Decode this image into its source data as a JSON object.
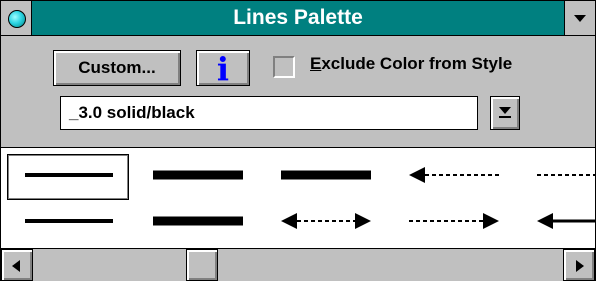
{
  "window": {
    "title": "Lines Palette"
  },
  "toolbar": {
    "custom_label": "Custom...",
    "info_label": "i",
    "exclude_checkbox": {
      "checked": false,
      "label_accel": "E",
      "label_rest": "xclude Color from Style"
    }
  },
  "style_select": {
    "value": "_3.0 solid/black"
  },
  "palette": {
    "selected_index": 0,
    "items": [
      {
        "name": "thin-solid",
        "row": 0
      },
      {
        "name": "thick-solid",
        "row": 0
      },
      {
        "name": "thick-solid-2",
        "row": 0
      },
      {
        "name": "dashed-arrow-left",
        "row": 0
      },
      {
        "name": "dashed",
        "row": 0
      },
      {
        "name": "thin-solid",
        "row": 1
      },
      {
        "name": "thick-solid",
        "row": 1
      },
      {
        "name": "dashed-double-arrow",
        "row": 1
      },
      {
        "name": "dashed-arrow-right",
        "row": 1
      },
      {
        "name": "solid-arrow-left",
        "row": 1
      }
    ]
  },
  "scrollbar": {
    "orientation": "horizontal"
  },
  "colors": {
    "titlebar": "#008080",
    "face": "#c0c0c0",
    "info_icon": "#0000ff"
  }
}
